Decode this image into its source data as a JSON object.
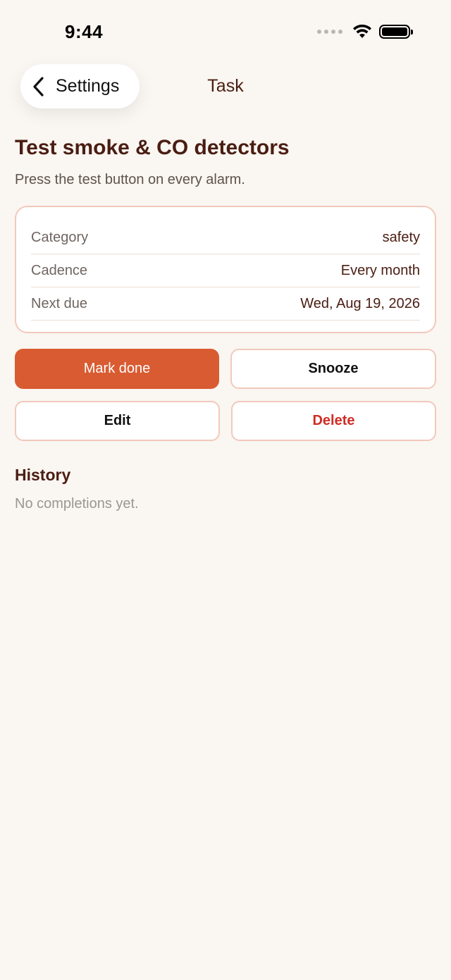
{
  "status_bar": {
    "time": "9:44"
  },
  "nav": {
    "back_label": "Settings",
    "title": "Task"
  },
  "task": {
    "title": "Test smoke & CO detectors",
    "description": "Press the test button on every alarm."
  },
  "details": [
    {
      "label": "Category",
      "value": "safety"
    },
    {
      "label": "Cadence",
      "value": "Every month"
    },
    {
      "label": "Next due",
      "value": "Wed, Aug 19, 2026"
    }
  ],
  "actions": {
    "mark_done": "Mark done",
    "snooze": "Snooze",
    "edit": "Edit",
    "delete": "Delete"
  },
  "history": {
    "title": "History",
    "empty": "No completions yet."
  },
  "colors": {
    "accent": "#d95b31",
    "danger": "#cf2d25",
    "title": "#4a1d12",
    "background": "#faf6f2",
    "border": "#f2c9bb"
  }
}
